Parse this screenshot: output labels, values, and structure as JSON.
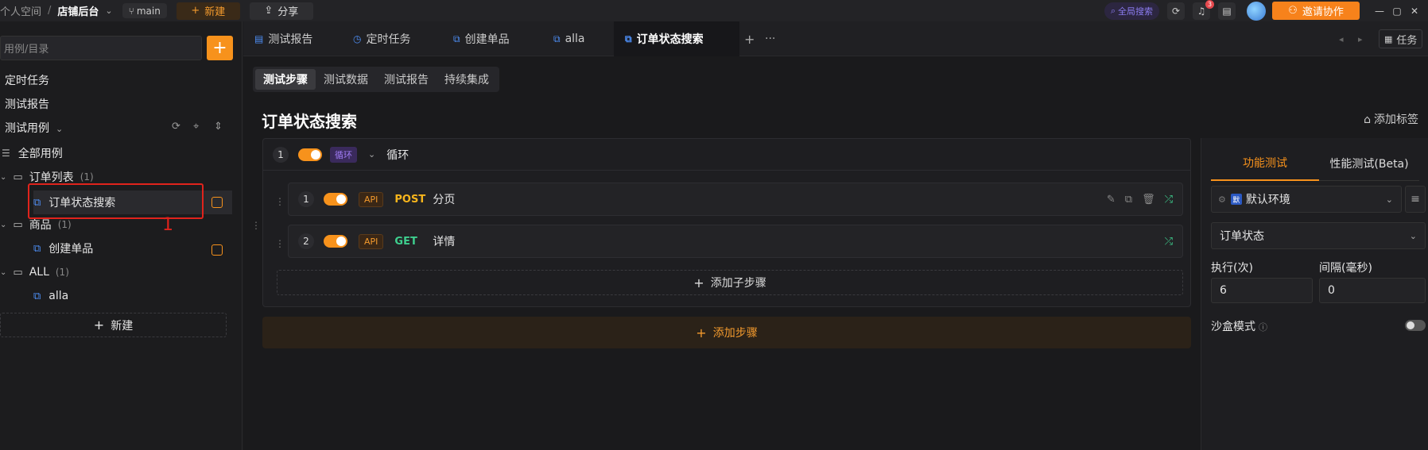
{
  "topbar": {
    "workspace": "个人空间",
    "project": "店铺后台",
    "branch": "main",
    "new_label": "新建",
    "share_label": "分享",
    "global_search": "全局搜索",
    "notif_count": "3",
    "invite_label": "邀请协作"
  },
  "sidebar": {
    "search_placeholder": "用例/目录",
    "items": [
      {
        "label": "定时任务"
      },
      {
        "label": "测试报告"
      },
      {
        "label": "测试用例"
      }
    ],
    "all_cases": "全部用例",
    "tree": [
      {
        "label": "订单列表",
        "count": "(1)",
        "children": [
          {
            "label": "订单状态搜索"
          }
        ]
      },
      {
        "label": "商品",
        "count": "(1)",
        "children": [
          {
            "label": "创建单品"
          }
        ]
      },
      {
        "label": "ALL",
        "count": "(1)",
        "children": [
          {
            "label": "alla"
          }
        ]
      }
    ],
    "new_label": "新建",
    "annotation_number": "1"
  },
  "tabs": [
    {
      "label": "测试报告"
    },
    {
      "label": "定时任务"
    },
    {
      "label": "创建单品"
    },
    {
      "label": "alla"
    },
    {
      "label": "订单状态搜索"
    }
  ],
  "tabs_right": {
    "task_label": "任务"
  },
  "subtabs": [
    {
      "label": "测试步骤"
    },
    {
      "label": "测试数据"
    },
    {
      "label": "测试报告"
    },
    {
      "label": "持续集成"
    }
  ],
  "page": {
    "title": "订单状态搜索",
    "add_tag": "添加标签"
  },
  "loop": {
    "index": "1",
    "tag": "循环",
    "name": "循环"
  },
  "steps": [
    {
      "index": "1",
      "tag": "API",
      "method": "POST",
      "name": "分页"
    },
    {
      "index": "2",
      "tag": "API",
      "method": "GET",
      "name": "详情"
    }
  ],
  "add_sub_step": "添加子步骤",
  "add_step": "添加步骤",
  "right_panel": {
    "tab_functional": "功能测试",
    "tab_performance": "性能测试(Beta)",
    "env": "默认环境",
    "dataset": "订单状态",
    "exec_label": "执行(次)",
    "interval_label": "间隔(毫秒)",
    "exec_value": "6",
    "interval_value": "0",
    "sandbox_label": "沙盒模式"
  },
  "colors": {
    "accent": "#f7921c",
    "loop_tag": "#a07cf5",
    "get": "#3ecf8e",
    "post": "#f7b51c",
    "annotation": "#e0231c"
  }
}
